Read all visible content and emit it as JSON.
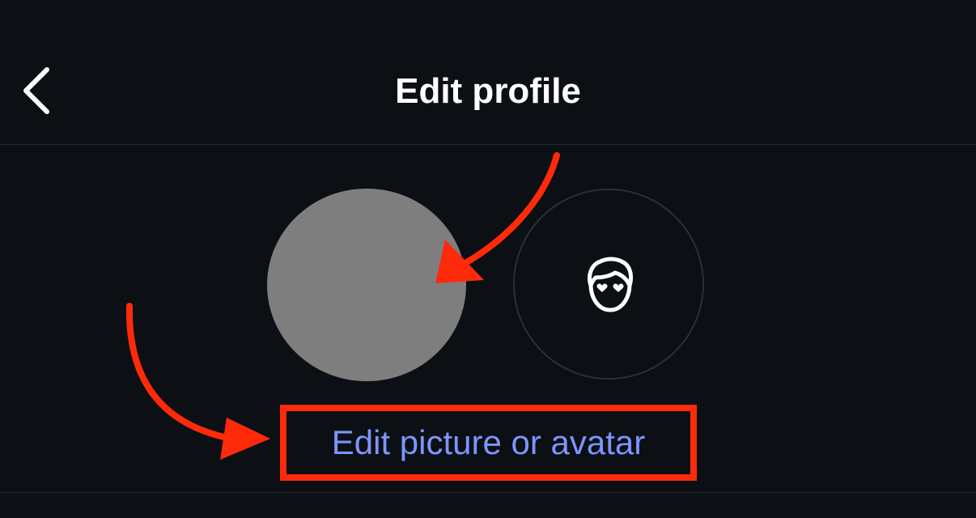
{
  "header": {
    "title": "Edit profile",
    "back_icon": "chevron-left-icon"
  },
  "profile": {
    "photo": "profile-photo-placeholder",
    "avatar_icon": "avatar-face-heart-eyes-icon",
    "edit_link_label": "Edit picture or avatar"
  },
  "annotations": {
    "arrow_color": "#ff2a0a",
    "highlight_color": "#ff2a0a"
  },
  "colors": {
    "background": "#0c0f14",
    "link": "#7c95ff",
    "photo": "#7e7e7e"
  }
}
